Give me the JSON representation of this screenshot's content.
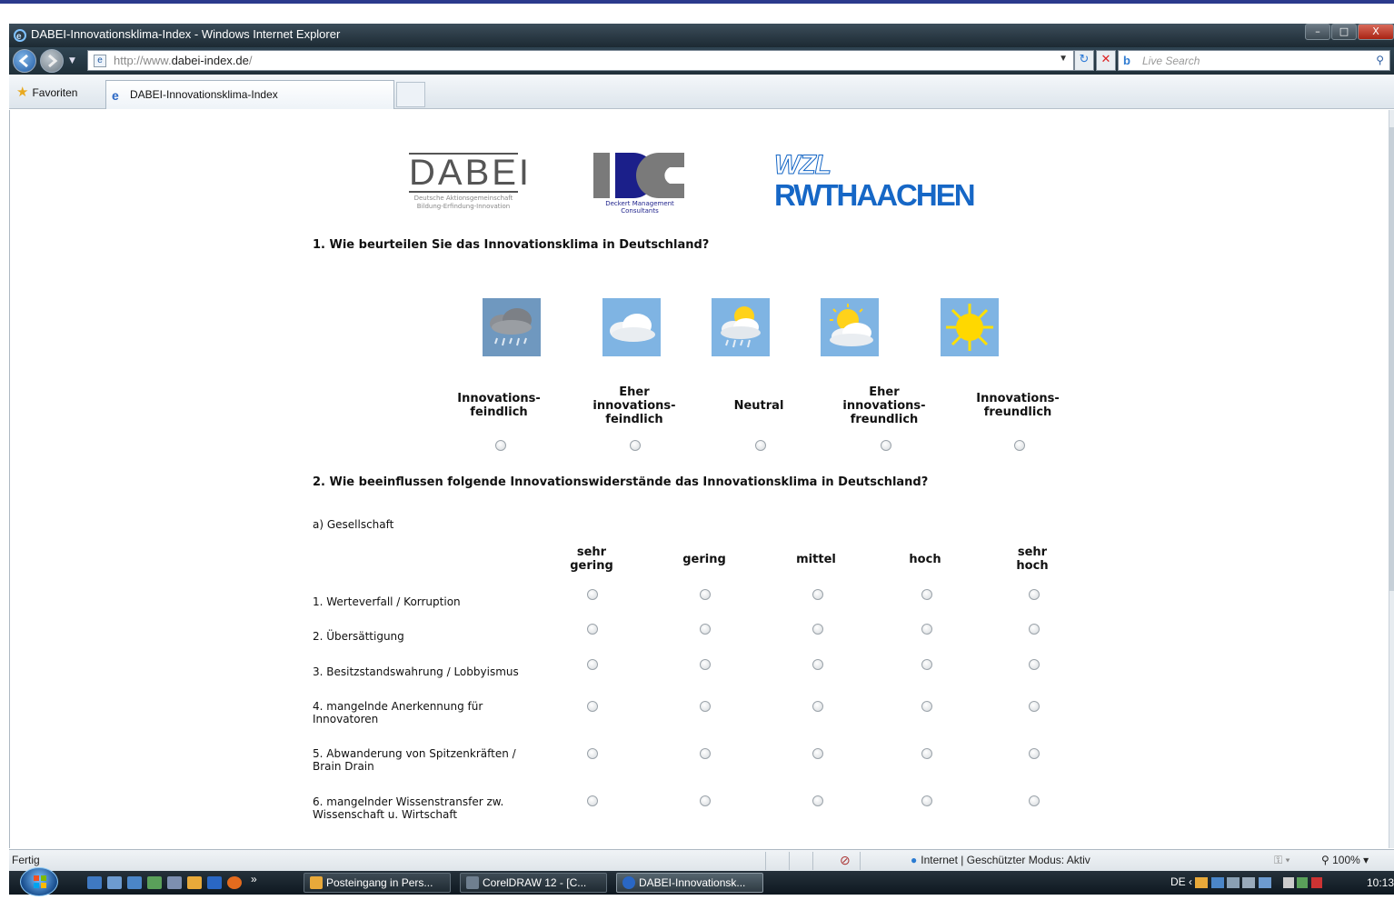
{
  "browser": {
    "window_title": "DABEI-Innovationsklima-Index - Windows Internet Explorer",
    "url_prefix": "http://www.",
    "url_host": "dabei-index.de",
    "url_suffix": "/",
    "search_placeholder": "Live Search",
    "favorites_label": "Favoriten",
    "tab_label": "DABEI-Innovationsklima-Index",
    "window_buttons": [
      "–",
      "□",
      "X"
    ]
  },
  "logos": {
    "dabei_word": "DABEI",
    "dabei_sub1": "Deutsche Aktionsgemeinschaft",
    "dabei_sub2": "Bildung-Erfindung-Innovation",
    "ddc_sub": "Deckert Management Consultants",
    "wzl": "WZL",
    "rwth": "RWTHAACHEN"
  },
  "q1": {
    "title": "1. Wie beurteilen Sie das Innovationsklima in Deutschland?",
    "options": [
      {
        "label": "Innovations-\nfeindlich",
        "icon": "rain-cloud-icon"
      },
      {
        "label": "Eher\ninnovations-\nfeindlich",
        "icon": "cloud-icon"
      },
      {
        "label": "Neutral",
        "icon": "sun-cloud-rain-icon"
      },
      {
        "label": "Eher\ninnovations-\nfreundlich",
        "icon": "sun-cloud-icon"
      },
      {
        "label": "Innovations-\nfreundlich",
        "icon": "sun-icon"
      }
    ]
  },
  "q2": {
    "title": "2. Wie beeinflussen folgende Innovationswiderstände das Innovationsklima in Deutschland?",
    "subsection": "a) Gesellschaft",
    "columns": [
      "sehr\ngering",
      "gering",
      "mittel",
      "hoch",
      "sehr\nhoch"
    ],
    "rows": [
      "1. Werteverfall / Korruption",
      "2. Übersättigung",
      "3. Besitzstandswahrung / Lobbyismus",
      "4. mangelnde Anerkennung für\nInnovatoren",
      "5. Abwanderung von Spitzenkräften /\nBrain Drain",
      "6. mangelnder Wissenstransfer zw.\nWissenschaft u. Wirtschaft"
    ]
  },
  "status": {
    "left": "Fertig",
    "zone": "Internet | Geschützter Modus: Aktiv",
    "zoom": "100%"
  },
  "taskbar": {
    "buttons": [
      "Posteingang in Pers...",
      "CorelDRAW 12 - [C...",
      "DABEI-Innovationsk..."
    ],
    "lang": "DE",
    "time": "10:13",
    "overflow": "»"
  },
  "colors": {
    "sky": "#7fb4e3",
    "logo_blue": "#1667c6",
    "ddc_navy": "#1b1f8a"
  }
}
